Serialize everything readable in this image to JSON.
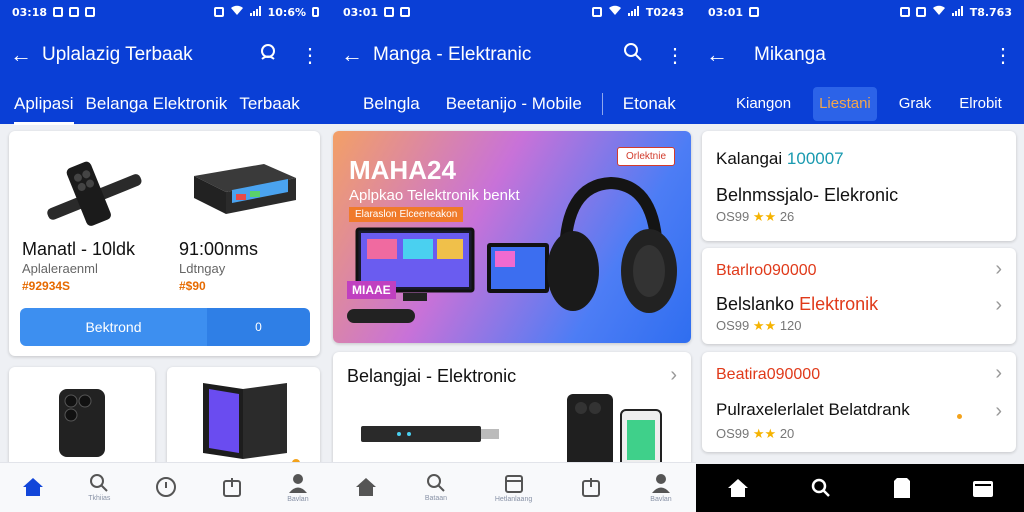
{
  "colors": {
    "brand_blue": "#0a3fd6",
    "button_blue": "#3d8ff0",
    "price_orange": "#e66a00"
  },
  "panel1": {
    "status": {
      "time": "03:18",
      "battery": "10:6%"
    },
    "title": "Uplalazig Terbaak",
    "tabs": [
      "Aplipasi",
      "Belanga Elektronik",
      "Terbaak"
    ],
    "product1": {
      "name": "Manatl - 10ldk",
      "sub": "Aplaleraenml",
      "price": "#92934S"
    },
    "product2": {
      "name": "91:00nms",
      "sub": "Ldtngay",
      "price": "#$90"
    },
    "button_label": "Bektrond",
    "button_side": "0",
    "nav": [
      {
        "icon": "home-icon",
        "label": ""
      },
      {
        "icon": "search-icon",
        "label": "Tkhiias"
      },
      {
        "icon": "clock-icon",
        "label": ""
      },
      {
        "icon": "bag-icon",
        "label": ""
      },
      {
        "icon": "user-icon",
        "label": "Bavlan"
      }
    ]
  },
  "panel2": {
    "status": {
      "time": "03:01",
      "battery": "T0243"
    },
    "title": "Manga - Elektranic",
    "tabs": [
      "Belngla",
      "Beetanijo - Mobile",
      "Etonak"
    ],
    "banner": {
      "badge": "Orlektnie",
      "headline": "MAHA24",
      "subline": "Aplpkao Telektronik benkt",
      "strip": "Elaraslon Elceeneakon",
      "tag": "MIAAE"
    },
    "section_title": "Belangjai - Elektronic",
    "nav": [
      {
        "icon": "home-icon",
        "label": ""
      },
      {
        "icon": "search-icon",
        "label": "Bataan"
      },
      {
        "icon": "box-icon",
        "label": "Hetlanlaang"
      },
      {
        "icon": "bag-icon",
        "label": ""
      },
      {
        "icon": "user-icon",
        "label": "Bavlan"
      }
    ]
  },
  "panel3": {
    "status": {
      "time": "03:01",
      "battery": "T8.763"
    },
    "title": "Mikanga",
    "tabs": [
      "Kiangon",
      "Liestani",
      "Grak",
      "Elrobit"
    ],
    "items": [
      {
        "title": "Kalangai",
        "title_accent": "100007",
        "name": "Belnmssjalo- Elekronic",
        "name_accent": "",
        "meta": "OS99",
        "rating": "26"
      },
      {
        "title": "Btarlro090000",
        "title_accent": "",
        "name": "Belslanko",
        "name_accent": "Elektronik",
        "meta": "OS99",
        "rating": "120"
      },
      {
        "title": "Beatira090000",
        "title_accent": "",
        "name": "Pulraxelerlalet Belatdrank",
        "name_accent": "",
        "meta": "OS99",
        "rating": "20"
      }
    ],
    "nav": [
      {
        "icon": "home-icon"
      },
      {
        "icon": "search-icon"
      },
      {
        "icon": "file-icon"
      },
      {
        "icon": "wallet-icon"
      }
    ]
  }
}
